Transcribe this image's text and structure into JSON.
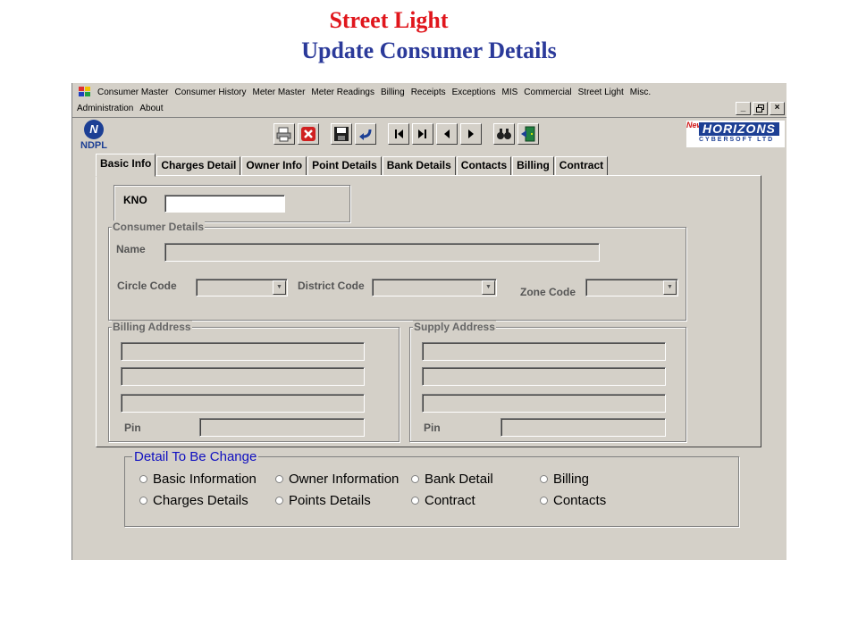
{
  "heading": {
    "title": "Street Light",
    "subtitle": "Update Consumer Details"
  },
  "menu": {
    "row1": [
      "Consumer Master",
      "Consumer History",
      "Meter Master",
      "Meter Readings",
      "Billing",
      "Receipts",
      "Exceptions",
      "MIS",
      "Commercial",
      "Street Light",
      "Misc."
    ],
    "row2": [
      "Administration",
      "About"
    ]
  },
  "window_buttons": [
    "_",
    " ",
    "×"
  ],
  "logos": {
    "ndpl": "NDPL",
    "horizons_new": "New",
    "horizons_title": "HORIZONS",
    "horizons_sub": "CYBERSOFT LTD"
  },
  "toolbar": [
    "print-icon",
    "delete-icon",
    "save-icon",
    "undo-icon",
    "first-icon",
    "last-icon",
    "previous-icon",
    "next-icon",
    "find-icon",
    "exit-icon"
  ],
  "tabs": [
    "Basic Info",
    "Charges Detail",
    "Owner Info",
    "Point Details",
    "Bank Details",
    "Contacts",
    "Billing",
    "Contract"
  ],
  "form": {
    "kno_label": "KNO",
    "kno_value": "",
    "consumer_details_title": "Consumer Details",
    "name_label": "Name",
    "circle_code_label": "Circle Code",
    "district_code_label": "District Code",
    "zone_code_label": "Zone Code",
    "billing_address_title": "Billing Address",
    "supply_address_title": "Supply Address",
    "pin_label": "Pin"
  },
  "detail": {
    "title": "Detail To Be Change",
    "options": [
      "Basic Information",
      "Owner Information",
      "Bank Detail",
      "Billing",
      "Charges Details",
      "Points Details",
      "Contract",
      "Contacts"
    ]
  }
}
